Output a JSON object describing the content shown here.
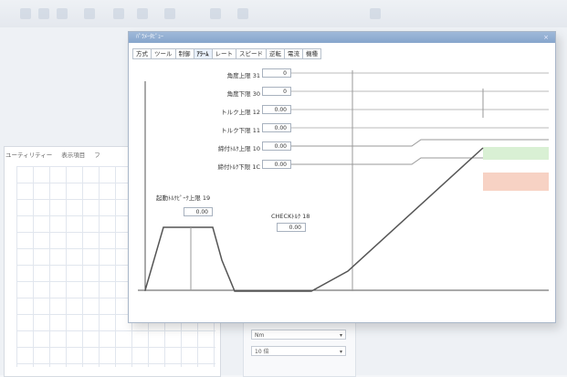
{
  "toolbar": {
    "icons": [
      "file-icon",
      "save-icon",
      "print-icon",
      "copy-icon",
      "cut-icon",
      "paste-icon",
      "chart-icon",
      "edit-icon",
      "zoom-icon",
      "settings-icon"
    ]
  },
  "background": {
    "tabs": [
      "ユーティリティー",
      "表示項目",
      "フ"
    ],
    "selects": [
      {
        "value": "Nm"
      },
      {
        "value": "10 倍"
      }
    ]
  },
  "dialog": {
    "title": "ﾊﾟﾗﾒｰﾀﾋﾞｭｰ",
    "close": "×",
    "tabs": [
      "方式",
      "ツール",
      "制御",
      "ｱﾗｰﾑ",
      "レート",
      "スピード",
      "逆転",
      "電流",
      "機種"
    ],
    "active_tab": 3,
    "params": [
      {
        "label": "角度上限 31",
        "value": "0"
      },
      {
        "label": "角度下限 30",
        "value": "0"
      },
      {
        "label": "トルク上限 12",
        "value": "0.00"
      },
      {
        "label": "トルク下限 11",
        "value": "0.00"
      },
      {
        "label": "締付ﾄﾙｸ上限 10",
        "value": "0.00"
      },
      {
        "label": "締付ﾄﾙｸ下限 1C",
        "value": "0.00"
      }
    ],
    "peak": {
      "label": "起動ﾄﾙｸﾋﾟｰｸ上限 19",
      "value": "0.00"
    },
    "check": {
      "label": "CHECKﾄﾙｸ 18",
      "value": "0.00"
    }
  },
  "colors": {
    "accent": "#8aa7cf",
    "ok_band": "#d9f0d4",
    "ng_band": "#f7d2c4",
    "curve": "#555555"
  }
}
